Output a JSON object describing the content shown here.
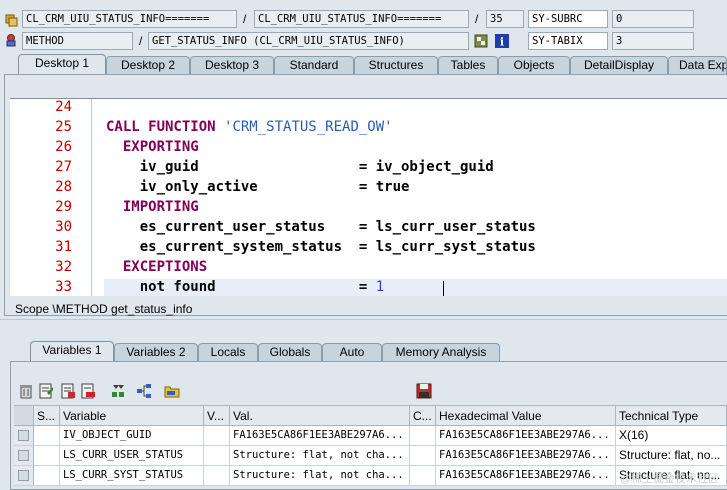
{
  "header": {
    "row1": {
      "field1": "CL_CRM_UIU_STATUS_INFO=======",
      "sep1": "/",
      "field2": "CL_CRM_UIU_STATUS_INFO=======",
      "sep2": "/",
      "line": "35",
      "sysvar": "SY-SUBRC",
      "sysval": "0"
    },
    "row2": {
      "type": "METHOD",
      "sep": "/",
      "name": "GET_STATUS_INFO (CL_CRM_UIU_STATUS_INFO)",
      "sysvar": "SY-TABIX",
      "sysval": "3"
    }
  },
  "top_tabs": [
    {
      "label": "Desktop 1",
      "active": true
    },
    {
      "label": "Desktop 2"
    },
    {
      "label": "Desktop 3"
    },
    {
      "label": "Standard"
    },
    {
      "label": "Structures"
    },
    {
      "label": "Tables"
    },
    {
      "label": "Objects"
    },
    {
      "label": "DetailDisplay"
    },
    {
      "label": "Data Exp"
    }
  ],
  "editor": {
    "lines": [
      {
        "n": "24",
        "parts": []
      },
      {
        "n": "25",
        "parts": [
          {
            "t": "CALL FUNCTION ",
            "c": "kw"
          },
          {
            "t": "'CRM_STATUS_READ_OW'",
            "c": "str"
          }
        ]
      },
      {
        "n": "26",
        "parts": [
          {
            "t": "  EXPORTING",
            "c": "kw"
          }
        ]
      },
      {
        "n": "27",
        "parts": [
          {
            "t": "    iv_guid                   = iv_object_guid",
            "c": "plain"
          }
        ]
      },
      {
        "n": "28",
        "parts": [
          {
            "t": "    iv_only_active            = true",
            "c": "plain"
          }
        ]
      },
      {
        "n": "29",
        "parts": [
          {
            "t": "  IMPORTING",
            "c": "kw"
          }
        ]
      },
      {
        "n": "30",
        "parts": [
          {
            "t": "    es_current_user_status    = ls_curr_user_status",
            "c": "plain"
          }
        ]
      },
      {
        "n": "31",
        "parts": [
          {
            "t": "    es_current_system_status  = ls_curr_syst_status",
            "c": "plain"
          }
        ]
      },
      {
        "n": "32",
        "parts": [
          {
            "t": "  EXCEPTIONS",
            "c": "kw"
          }
        ]
      },
      {
        "n": "33",
        "parts": [
          {
            "t": "    not found                 = ",
            "c": "plain"
          },
          {
            "t": "1",
            "c": "num"
          }
        ]
      }
    ]
  },
  "scope": "Scope \\METHOD get_status_info",
  "bottom_tabs": [
    {
      "label": "Variables 1",
      "active": true
    },
    {
      "label": "Variables 2"
    },
    {
      "label": "Locals"
    },
    {
      "label": "Globals"
    },
    {
      "label": "Auto"
    },
    {
      "label": "Memory Analysis"
    }
  ],
  "table": {
    "headers": [
      "S...",
      "Variable",
      "V...",
      "Val.",
      "C...",
      "Hexadecimal Value",
      "Technical Type"
    ],
    "rows": [
      {
        "variable": "IV_OBJECT_GUID",
        "value": "FA163E5CA86F1EE3ABE297A6...",
        "hex": "FA163E5CA86F1EE3ABE297A6...",
        "type": "X(16)"
      },
      {
        "variable": "LS_CURR_USER_STATUS",
        "value": "Structure: flat, not cha...",
        "hex": "FA163E5CA86F1EE3ABE297A6...",
        "type": "Structure: flat, no..."
      },
      {
        "variable": "LS_CURR_SYST_STATUS",
        "value": "Structure: flat, not cha...",
        "hex": "FA163E5CA86F1EE3ABE297A6...",
        "type": "Structure: flat, no..."
      }
    ]
  },
  "watermark": "@稀土掘金技术社区"
}
